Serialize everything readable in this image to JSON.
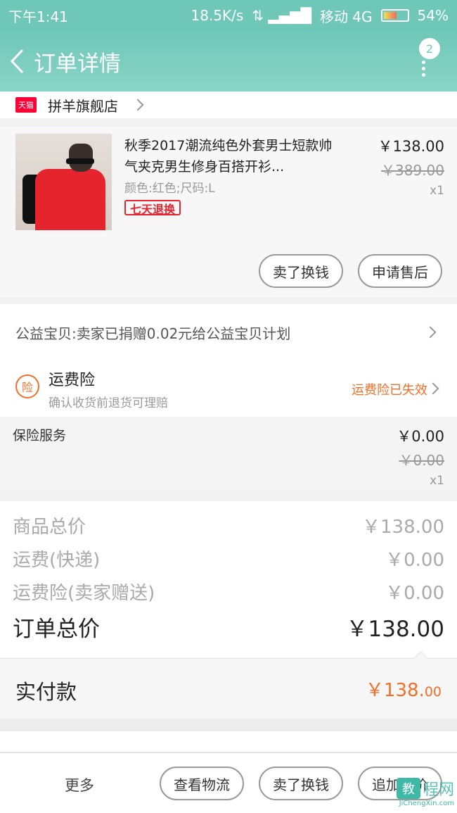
{
  "status_bar": {
    "time": "下午1:41",
    "net_speed": "18.5K/s",
    "carrier": "移动 4G",
    "battery": "54%"
  },
  "nav": {
    "title": "订单详情",
    "badge": "2"
  },
  "store": {
    "platform_icon": "天猫",
    "name": "拼羊旗舰店"
  },
  "product": {
    "title": "秋季2017潮流纯色外套男士短款帅气夹克男生修身百搭开衫...",
    "spec": "颜色:红色;尺码:L",
    "tag": "七天退换",
    "price": "￥138.00",
    "original_price": "￥389.00",
    "quantity": "x1",
    "sell_btn": "卖了换钱",
    "aftersale_btn": "申请售后"
  },
  "charity": {
    "text": "公益宝贝:卖家已捐赠0.02元给公益宝贝计划"
  },
  "insurance": {
    "icon": "险",
    "title": "运费险",
    "subtitle": "确认收货前退货可理赔",
    "status": "运费险已失效"
  },
  "service": {
    "label": "保险服务",
    "price": "￥0.00",
    "original_price": "￥0.00",
    "quantity": "x1"
  },
  "summary": {
    "goods_label": "商品总价",
    "goods_value": "￥138.00",
    "shipping_label": "运费(快递)",
    "shipping_value": "￥0.00",
    "insurance_label": "运费险(卖家赠送)",
    "insurance_value": "￥0.00",
    "total_label": "订单总价",
    "total_value": "￥138.00"
  },
  "paid": {
    "label": "实付款",
    "amount_main": "￥138.",
    "amount_decimal": "00"
  },
  "bottom": {
    "more": "更多",
    "logistics_btn": "查看物流",
    "sell_btn": "卖了换钱",
    "review_btn": "追加评价"
  },
  "watermark": {
    "badge": "教",
    "text": "程网",
    "url": "JiChengXin.com"
  },
  "colors": {
    "header": "#6fc7b7",
    "accent_orange": "#f36f27",
    "tmall_red": "#ff0036"
  }
}
